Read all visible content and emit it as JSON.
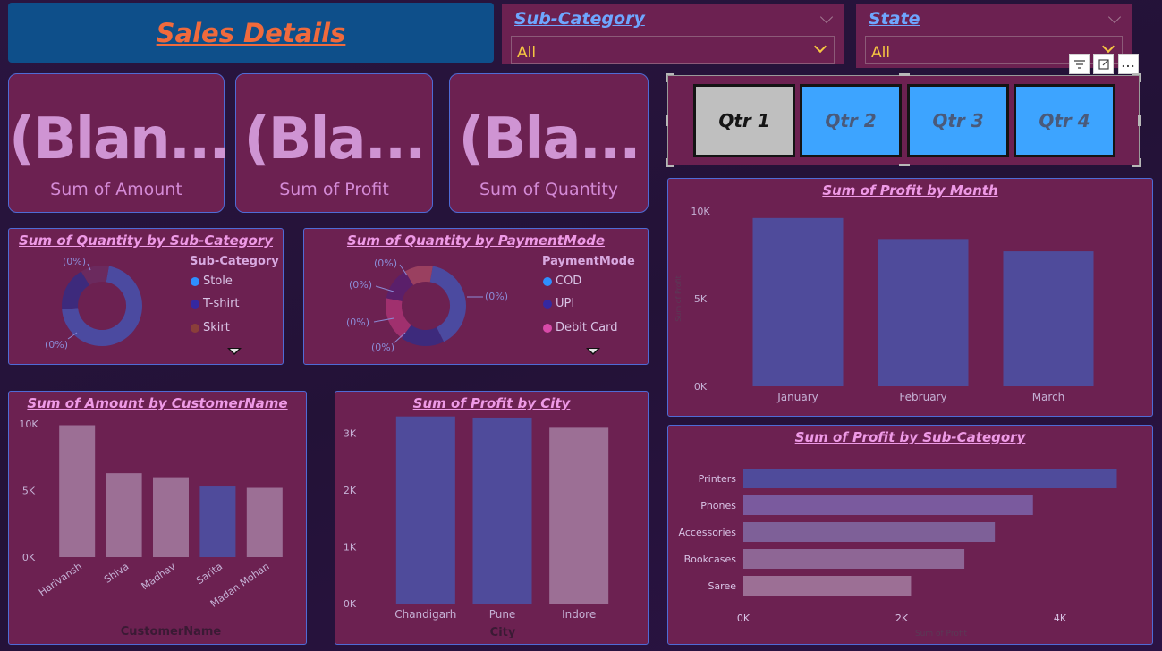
{
  "header": {
    "title": "Sales Details"
  },
  "slicers": {
    "subcategory": {
      "title": "Sub-Category",
      "value": "All"
    },
    "state": {
      "title": "State",
      "value": "All"
    }
  },
  "kpis": [
    {
      "value": "(Blan...",
      "label": "Sum of Amount"
    },
    {
      "value": "(Bla...",
      "label": "Sum of Profit"
    },
    {
      "value": "(Bla...",
      "label": "Sum of Quantity"
    }
  ],
  "quarters": {
    "buttons": [
      "Qtr 1",
      "Qtr 2",
      "Qtr 3",
      "Qtr 4"
    ],
    "selected": "Qtr 1"
  },
  "toolbar": {
    "filter_icon": "filter-icon",
    "focus_icon": "focus-mode-icon",
    "more_icon": "more-options-icon",
    "more_label": "..."
  },
  "donut_subcat": {
    "title": "Sum of Quantity by Sub-Category",
    "legend_title": "Sub-Category",
    "legend": [
      {
        "name": "Stole",
        "color": "#2e8fff"
      },
      {
        "name": "T-shirt",
        "color": "#3528a0"
      },
      {
        "name": "Skirt",
        "color": "#8a3f3a"
      }
    ],
    "labels": [
      "(0%)",
      "(0%)"
    ]
  },
  "donut_payment": {
    "title": "Sum of Quantity by PaymentMode",
    "legend_title": "PaymentMode",
    "legend": [
      {
        "name": "COD",
        "color": "#2e8fff"
      },
      {
        "name": "UPI",
        "color": "#3528a0"
      },
      {
        "name": "Debit Card",
        "color": "#d84aa8"
      }
    ],
    "labels": [
      "(0%)",
      "(0%)",
      "(0%)",
      "(0%)",
      "(0%)"
    ]
  },
  "chart_data": [
    {
      "type": "bar",
      "title": "Sum of Profit by Month",
      "categories": [
        "January",
        "February",
        "March"
      ],
      "values": [
        9600,
        8400,
        7700
      ],
      "ylabel": "Sum of Profit",
      "xlabel": "",
      "ylim": [
        0,
        10000
      ],
      "yticks": [
        "0K",
        "5K",
        "10K"
      ]
    },
    {
      "type": "bar",
      "title": "Sum of Amount by CustomerName",
      "categories": [
        "Harivansh",
        "Shiva",
        "Madhav",
        "Sarita",
        "Madan Mohan"
      ],
      "values": [
        9900,
        6300,
        6000,
        5300,
        5200
      ],
      "xlabel": "CustomerName",
      "ylabel": "",
      "ylim": [
        0,
        10000
      ],
      "yticks": [
        "0K",
        "5K",
        "10K"
      ]
    },
    {
      "type": "bar",
      "title": "Sum of Profit by City",
      "categories": [
        "Chandigarh",
        "Pune",
        "Indore"
      ],
      "values": [
        3300,
        3280,
        3100
      ],
      "xlabel": "City",
      "ylabel": "",
      "ylim": [
        0,
        3500
      ],
      "yticks": [
        "0K",
        "1K",
        "2K",
        "3K"
      ]
    },
    {
      "type": "bar",
      "orientation": "horizontal",
      "title": "Sum of Profit by Sub-Category",
      "categories": [
        "Printers",
        "Phones",
        "Accessories",
        "Bookcases",
        "Saree"
      ],
      "values": [
        4900,
        3800,
        3300,
        2900,
        2200
      ],
      "xlabel": "Sum of Profit",
      "ylabel": "",
      "xlim": [
        0,
        5000
      ],
      "xticks": [
        "0K",
        "2K",
        "4K"
      ]
    }
  ]
}
